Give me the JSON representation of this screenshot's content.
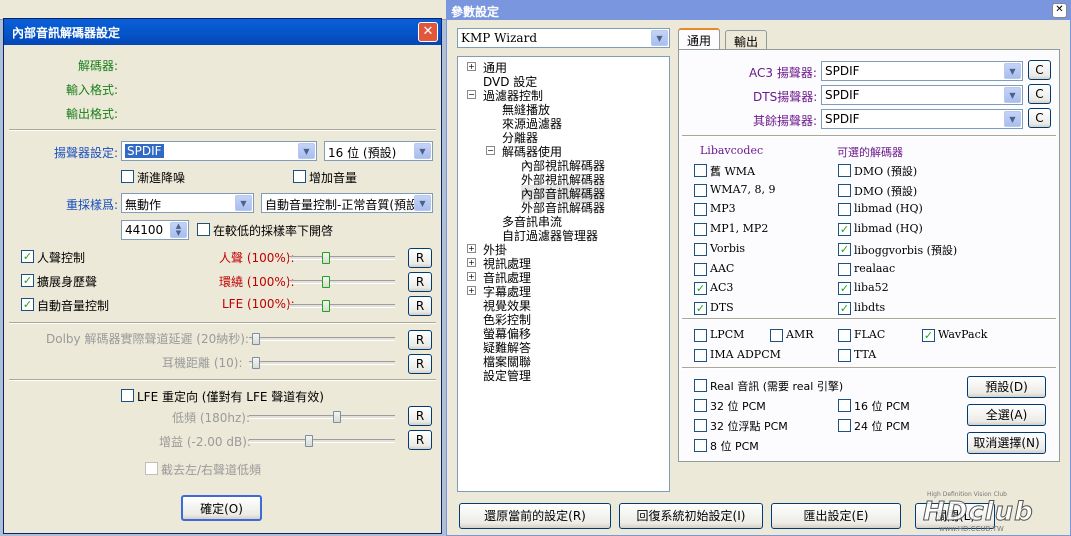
{
  "left_dialog": {
    "title": "內部音訊解碼器設定",
    "decoder_label": "解碼器:",
    "input_format_label": "輸入格式:",
    "output_format_label": "輸出格式:",
    "speaker_setting_label": "揚聲器設定:",
    "speaker_value": "SPDIF",
    "bits_value": "16 位 (預設)",
    "gradual_denoise": "漸進降噪",
    "increase_volume": "增加音量",
    "resample_label": "重採樣爲:",
    "resample_value": "無動作",
    "auto_volume_value": "自動音量控制-正常音質(預設)",
    "sample_rate": "44100",
    "low_rate_only": "在較低的採樣率下開啓",
    "voice_control": "人聲控制",
    "voice_pct": "人聲 (100%):",
    "ext_sound": "擴展身歷聲",
    "surround_pct": "環繞 (100%):",
    "auto_vol_ctrl": "自動音量控制",
    "lfe_pct": "LFE (100%):",
    "dolby_delay": "Dolby 解碼器實際聲道延遲 (20納秒):",
    "headphone_distance": "耳機距離 (10):",
    "lfe_redirect": "LFE 重定向 (僅對有 LFE 聲道有效)",
    "low_freq": "低頻 (180hz):",
    "gain": "增益 (-2.00 dB):",
    "cut_lr_low": "截去左/右聲道低頻",
    "r_label": "R",
    "ok_button": "確定(O)"
  },
  "right_window": {
    "title": "參數設定",
    "preset_combo": "KMP Wizard",
    "tree": [
      {
        "label": "通用",
        "expander": "+"
      },
      {
        "label": "DVD 設定",
        "expander": ""
      },
      {
        "label": "過濾器控制",
        "expander": "−"
      },
      {
        "label": "無縫播放",
        "expander": ""
      },
      {
        "label": "來源過濾器",
        "expander": ""
      },
      {
        "label": "分離器",
        "expander": ""
      },
      {
        "label": "解碼器使用",
        "expander": "−"
      },
      {
        "label": "內部視訊解碼器",
        "expander": ""
      },
      {
        "label": "外部視訊解碼器",
        "expander": ""
      },
      {
        "label": "內部音訊解碼器",
        "expander": ""
      },
      {
        "label": "外部音訊解碼器",
        "expander": ""
      },
      {
        "label": "多音訊串流",
        "expander": ""
      },
      {
        "label": "自訂過濾器管理器",
        "expander": ""
      },
      {
        "label": "外掛",
        "expander": "+"
      },
      {
        "label": "視訊處理",
        "expander": "+"
      },
      {
        "label": "音訊處理",
        "expander": "+"
      },
      {
        "label": "字幕處理",
        "expander": "+"
      },
      {
        "label": "視覺效果",
        "expander": ""
      },
      {
        "label": "色彩控制",
        "expander": ""
      },
      {
        "label": "螢幕偏移",
        "expander": ""
      },
      {
        "label": "疑難解答",
        "expander": ""
      },
      {
        "label": "檔案關聯",
        "expander": ""
      },
      {
        "label": "設定管理",
        "expander": ""
      }
    ],
    "tabs": [
      "通用",
      "輸出"
    ],
    "ac3_label": "AC3 揚聲器:",
    "ac3_value": "SPDIF",
    "dts_label": "DTS揚聲器:",
    "dts_value": "SPDIF",
    "other_label": "其餘揚聲器:",
    "other_value": "SPDIF",
    "c_label": "C",
    "libavcodec_header": "Libavcodec",
    "optional_header": "可選的解碼器",
    "left_codecs": [
      {
        "label": "舊 WMA",
        "checked": false
      },
      {
        "label": "WMA7, 8, 9",
        "checked": false
      },
      {
        "label": "MP3",
        "checked": false
      },
      {
        "label": "MP1, MP2",
        "checked": false
      },
      {
        "label": "Vorbis",
        "checked": false
      },
      {
        "label": "AAC",
        "checked": false
      },
      {
        "label": "AC3",
        "checked": true
      },
      {
        "label": "DTS",
        "checked": true
      }
    ],
    "right_codecs": [
      {
        "label": "DMO (預設)",
        "checked": false
      },
      {
        "label": "DMO (預設)",
        "checked": false
      },
      {
        "label": "libmad (HQ)",
        "checked": false
      },
      {
        "label": "libmad (HQ)",
        "checked": true
      },
      {
        "label": "liboggvorbis (預設)",
        "checked": true
      },
      {
        "label": "realaac",
        "checked": false
      },
      {
        "label": "liba52",
        "checked": true
      },
      {
        "label": "libdts",
        "checked": true
      }
    ],
    "row_lpcm": "LPCM",
    "row_amr": "AMR",
    "row_flac": "FLAC",
    "row_wavpack": "WavPack",
    "row_ima": "IMA ADPCM",
    "row_tta": "TTA",
    "real_audio": "Real 音訊 (需要 real 引擎)",
    "pcm32": "32 位 PCM",
    "pcm16": "16 位 PCM",
    "pcm32f": "32 位浮點 PCM",
    "pcm24": "24 位 PCM",
    "pcm8": "8 位 PCM",
    "default_btn": "預設(D)",
    "select_all_btn": "全選(A)",
    "deselect_btn": "取消選擇(N)",
    "restore_btn": "還原當前的設定(R)",
    "reset_btn": "回復系統初始設定(I)",
    "export_btn": "匯出設定(E)",
    "close_btn": "關閉(L)"
  },
  "watermark": {
    "text": "HDclub",
    "url": "www.HD.CCUB.TW",
    "tagline": "High Definition Vision Club"
  }
}
